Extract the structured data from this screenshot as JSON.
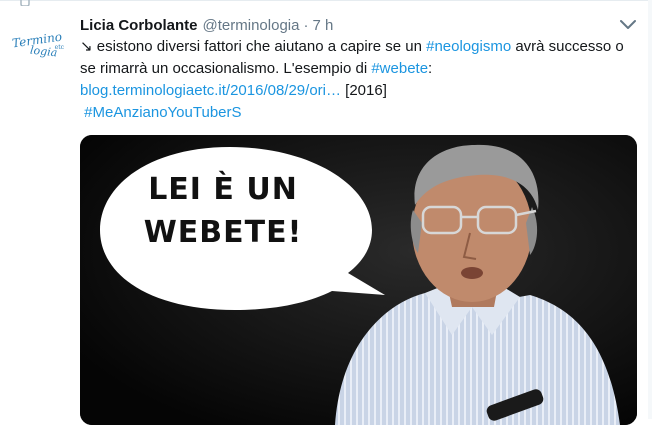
{
  "tweet": {
    "author_name": "Licia Corbolante",
    "handle": "@terminologia",
    "separator": "·",
    "time": "7 h",
    "avatar": {
      "line1": "Termino",
      "line2": "logia",
      "suffix": "etc"
    },
    "text": {
      "arrow": "↘",
      "part1": " esistono diversi fattori che aiutano a capire se un ",
      "hashtag1": "#neologismo",
      "part2": " avrà successo o se rimarrà un occasionalismo. L'esempio di ",
      "hashtag2": "#webete",
      "part3": ":",
      "link": "blog.terminologiaetc.it/2016/08/29/ori…",
      "bracket": " [2016]",
      "hashtag3": "#MeAnzianoYouTuberS"
    },
    "image": {
      "speech_line1": "LEI È UN",
      "speech_line2": "WEBETE!"
    }
  },
  "colors": {
    "link": "#1b95e0",
    "muted": "#657786",
    "text": "#14171a"
  }
}
